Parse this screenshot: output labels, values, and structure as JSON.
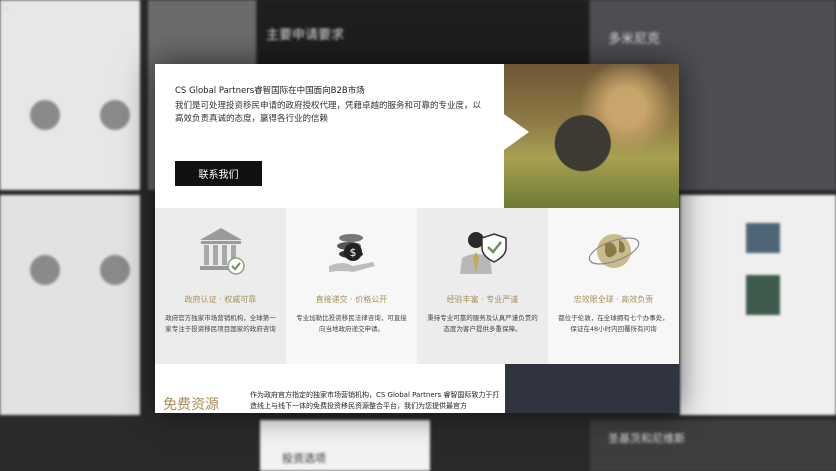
{
  "modal": {
    "title": "CS Global Partners睿智国际在中国面向B2B市场",
    "description": "我们是可处理投资移民申请的政府授权代理，凭藉卓越的服务和可靠的专业度，以高效负责真诚的态度，赢得各行业的信赖",
    "contact_button": "联系我们",
    "features": [
      {
        "title": "政府认证 · 权威可靠",
        "desc": "政府官方独家市场营销机构，全球第一家专注于投资移民项目国家的政府咨询",
        "icon": "bank-building-icon"
      },
      {
        "title": "直接递交 · 价格公开",
        "desc": "专业加勒比投资移民法律咨询，可直接向当地政府递交申请。",
        "icon": "money-hand-icon"
      },
      {
        "title": "经验丰富 · 专业严谨",
        "desc": "秉持专业可靠的服务及认真严谨负责的态度为客户提供多重保障。",
        "icon": "consultant-shield-icon"
      },
      {
        "title": "忠效眼全球 · 高效负责",
        "desc": "都位于伦敦，在全球拥有七个办事处，保证在48小时内回覆所有问询",
        "icon": "globe-icon"
      }
    ],
    "resources_title": "免费资源",
    "resources_desc": "作为政府官方指定的独家市场营销机构，CS Global Partners 睿智国际致力于打造线上与线下一体的免费投资移民资源整合平台，我们为您提供最官方"
  },
  "background": {
    "requirements_title": "主要申请要求",
    "dominica_title": "多米尼克",
    "investment_options": "投资选项",
    "saint_kitts_title": "圣基茨和尼维斯"
  },
  "colors": {
    "accent": "#a88f5a",
    "button": "#111111"
  }
}
